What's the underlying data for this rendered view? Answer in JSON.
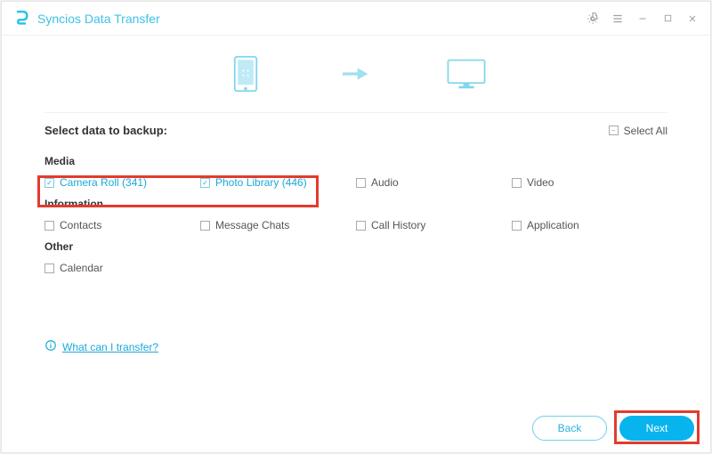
{
  "app": {
    "title": "Syncios Data Transfer"
  },
  "heading": "Select data to backup:",
  "selectAllLabel": "Select All",
  "categories": {
    "media": {
      "label": "Media",
      "items": [
        {
          "label": "Camera Roll (341)",
          "checked": true
        },
        {
          "label": "Photo Library (446)",
          "checked": true
        },
        {
          "label": "Audio",
          "checked": false
        },
        {
          "label": "Video",
          "checked": false
        }
      ]
    },
    "information": {
      "label": "Information",
      "items": [
        {
          "label": "Contacts",
          "checked": false
        },
        {
          "label": "Message Chats",
          "checked": false
        },
        {
          "label": "Call History",
          "checked": false
        },
        {
          "label": "Application",
          "checked": false
        }
      ]
    },
    "other": {
      "label": "Other",
      "items": [
        {
          "label": "Calendar",
          "checked": false
        }
      ]
    }
  },
  "help": {
    "label": "What can I transfer?"
  },
  "buttons": {
    "back": "Back",
    "next": "Next"
  }
}
